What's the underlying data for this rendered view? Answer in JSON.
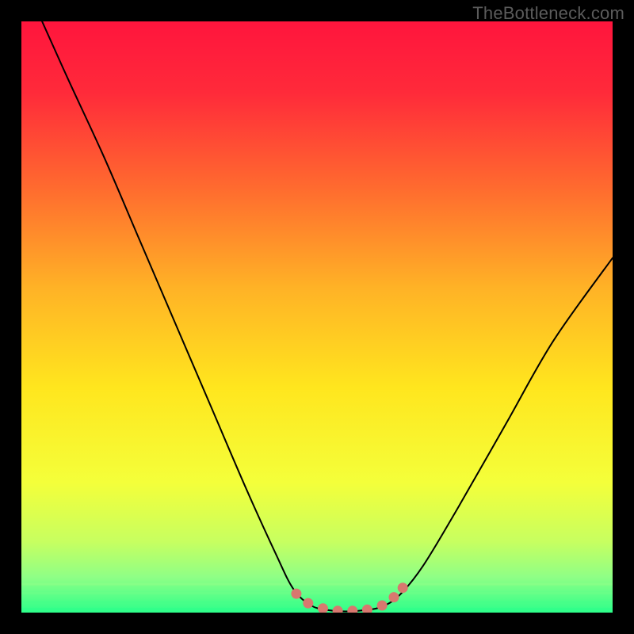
{
  "watermark": {
    "text": "TheBottleneck.com"
  },
  "chart_data": {
    "type": "line",
    "title": "",
    "xlabel": "",
    "ylabel": "",
    "xlim": [
      0,
      100
    ],
    "ylim": [
      0,
      100
    ],
    "grid": false,
    "legend": false,
    "gradient_stops": [
      {
        "offset": 0.0,
        "color": "#ff153d"
      },
      {
        "offset": 0.12,
        "color": "#ff2a3a"
      },
      {
        "offset": 0.28,
        "color": "#ff6a2f"
      },
      {
        "offset": 0.45,
        "color": "#ffb226"
      },
      {
        "offset": 0.62,
        "color": "#ffe61e"
      },
      {
        "offset": 0.78,
        "color": "#f4ff3a"
      },
      {
        "offset": 0.88,
        "color": "#c7ff60"
      },
      {
        "offset": 0.94,
        "color": "#8fff86"
      },
      {
        "offset": 1.0,
        "color": "#2dff8a"
      }
    ],
    "series": [
      {
        "name": "curve",
        "points": [
          {
            "x": 3.5,
            "y": 100.0
          },
          {
            "x": 8.0,
            "y": 90.0
          },
          {
            "x": 14.0,
            "y": 77.0
          },
          {
            "x": 20.0,
            "y": 63.0
          },
          {
            "x": 26.0,
            "y": 49.0
          },
          {
            "x": 32.0,
            "y": 35.0
          },
          {
            "x": 38.0,
            "y": 21.0
          },
          {
            "x": 43.0,
            "y": 10.0
          },
          {
            "x": 46.0,
            "y": 4.0
          },
          {
            "x": 49.0,
            "y": 1.2
          },
          {
            "x": 52.0,
            "y": 0.4
          },
          {
            "x": 55.0,
            "y": 0.2
          },
          {
            "x": 58.0,
            "y": 0.4
          },
          {
            "x": 61.0,
            "y": 1.0
          },
          {
            "x": 64.0,
            "y": 3.0
          },
          {
            "x": 68.0,
            "y": 8.0
          },
          {
            "x": 74.0,
            "y": 18.0
          },
          {
            "x": 82.0,
            "y": 32.0
          },
          {
            "x": 90.0,
            "y": 46.0
          },
          {
            "x": 100.0,
            "y": 60.0
          }
        ]
      }
    ],
    "highlight": {
      "color": "#d8786f",
      "points": [
        {
          "x": 46.5,
          "y": 3.2
        },
        {
          "x": 48.5,
          "y": 1.6
        },
        {
          "x": 51.0,
          "y": 0.7
        },
        {
          "x": 53.5,
          "y": 0.3
        },
        {
          "x": 56.0,
          "y": 0.3
        },
        {
          "x": 58.5,
          "y": 0.5
        },
        {
          "x": 61.0,
          "y": 1.2
        },
        {
          "x": 63.0,
          "y": 2.6
        },
        {
          "x": 64.5,
          "y": 4.2
        }
      ]
    },
    "green_bands": [
      {
        "y": 95.0,
        "color": "#8fff86"
      },
      {
        "y": 96.5,
        "color": "#6cff88"
      },
      {
        "y": 98.0,
        "color": "#45ff89"
      },
      {
        "y": 99.2,
        "color": "#2dff8a"
      }
    ]
  }
}
